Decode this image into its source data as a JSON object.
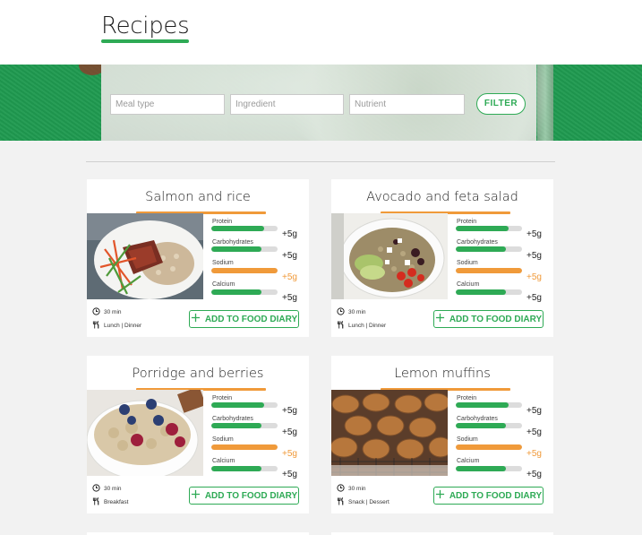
{
  "page": {
    "title": "Recipes"
  },
  "filters": {
    "meal_type_placeholder": "Meal type",
    "ingredient_placeholder": "Ingredient",
    "nutrient_placeholder": "Nutrient",
    "filter_label": "FILTER"
  },
  "colors": {
    "accent": "#2eaa55",
    "warning": "#f09a3a",
    "banner": "#1f9a50"
  },
  "icons": {
    "time": "clock-icon",
    "meals": "cutlery-icon",
    "add": "plus-icon"
  },
  "cards": [
    {
      "title": "Salmon and rice",
      "image": "salmon-rice-photo",
      "time": "30 min",
      "meals": "Lunch | Dinner",
      "add_label": "ADD TO FOOD DIARY",
      "nutrients": [
        {
          "name": "Protein",
          "value": "+5g",
          "level": 0.8,
          "status": "ok"
        },
        {
          "name": "Carbohydrates",
          "value": "+5g",
          "level": 0.75,
          "status": "ok"
        },
        {
          "name": "Sodium",
          "value": "+5g",
          "level": 1.0,
          "status": "warning"
        },
        {
          "name": "Calcium",
          "value": "+5g",
          "level": 0.75,
          "status": "ok"
        }
      ]
    },
    {
      "title": "Avocado and feta salad",
      "image": "avocado-feta-salad-photo",
      "time": "30 min",
      "meals": "Lunch | Dinner",
      "add_label": "ADD TO FOOD DIARY",
      "nutrients": [
        {
          "name": "Protein",
          "value": "+5g",
          "level": 0.8,
          "status": "ok"
        },
        {
          "name": "Carbohydrates",
          "value": "+5g",
          "level": 0.75,
          "status": "ok"
        },
        {
          "name": "Sodium",
          "value": "+5g",
          "level": 1.0,
          "status": "warning"
        },
        {
          "name": "Calcium",
          "value": "+5g",
          "level": 0.75,
          "status": "ok"
        }
      ]
    },
    {
      "title": "Porridge and berries",
      "image": "porridge-berries-photo",
      "time": "30 min",
      "meals": "Breakfast",
      "add_label": "ADD TO FOOD DIARY",
      "nutrients": [
        {
          "name": "Protein",
          "value": "+5g",
          "level": 0.8,
          "status": "ok"
        },
        {
          "name": "Carbohydrates",
          "value": "+5g",
          "level": 0.75,
          "status": "ok"
        },
        {
          "name": "Sodium",
          "value": "+5g",
          "level": 1.0,
          "status": "warning"
        },
        {
          "name": "Calcium",
          "value": "+5g",
          "level": 0.75,
          "status": "ok"
        }
      ]
    },
    {
      "title": "Lemon muffins",
      "image": "lemon-muffins-photo",
      "time": "30 min",
      "meals": "Snack | Dessert",
      "add_label": "ADD TO FOOD DIARY",
      "nutrients": [
        {
          "name": "Protein",
          "value": "+5g",
          "level": 0.8,
          "status": "ok"
        },
        {
          "name": "Carbohydrates",
          "value": "+5g",
          "level": 0.75,
          "status": "ok"
        },
        {
          "name": "Sodium",
          "value": "+5g",
          "level": 1.0,
          "status": "warning"
        },
        {
          "name": "Calcium",
          "value": "+5g",
          "level": 0.75,
          "status": "ok"
        }
      ]
    }
  ]
}
